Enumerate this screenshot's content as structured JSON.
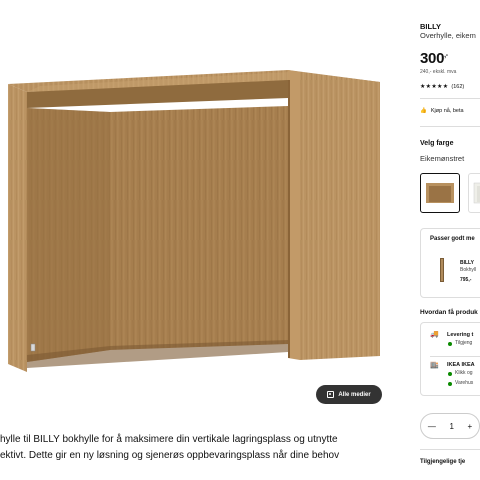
{
  "gallery": {
    "all_media_label": "Alle medier"
  },
  "description": {
    "lines": [
      "hylle til BILLY bokhylle for å maksimere din vertikale lagringsplass og utnytte",
      "ektivt. Dette gir en ny løsning og sjenerøs oppbevaringsplass når dine behov"
    ]
  },
  "product": {
    "name": "BILLY",
    "subtitle": "Overhylle, eikem",
    "price": "300",
    "price_suffix": ",-",
    "tax_note": "240,- ekskl. mva",
    "rating_count": "(162)",
    "stars": "★★★★★"
  },
  "buy": {
    "label": "Kjøp nå, beta"
  },
  "color": {
    "label": "Velg farge",
    "value": "Eikemønstret"
  },
  "fits": {
    "title": "Passer godt me",
    "item_name": "BILLY",
    "item_sub": "Bokhyll",
    "item_price": "795,-"
  },
  "how": {
    "title": "Hvordan få produk",
    "delivery_title": "Levering t",
    "delivery_sub": "Tilgjeng",
    "store_title": "IKEA IKEA",
    "store_sub1": "Klikk og",
    "store_sub2": "Varehus"
  },
  "quantity": {
    "minus": "—",
    "value": "1",
    "plus": "+"
  },
  "availability": {
    "label": "Tilgjengelige tje"
  },
  "colors": {
    "wood_light": "#b8915f",
    "wood_mid": "#a07a4b",
    "wood_dark": "#7d5a33",
    "status_green": "#0a8a00"
  }
}
